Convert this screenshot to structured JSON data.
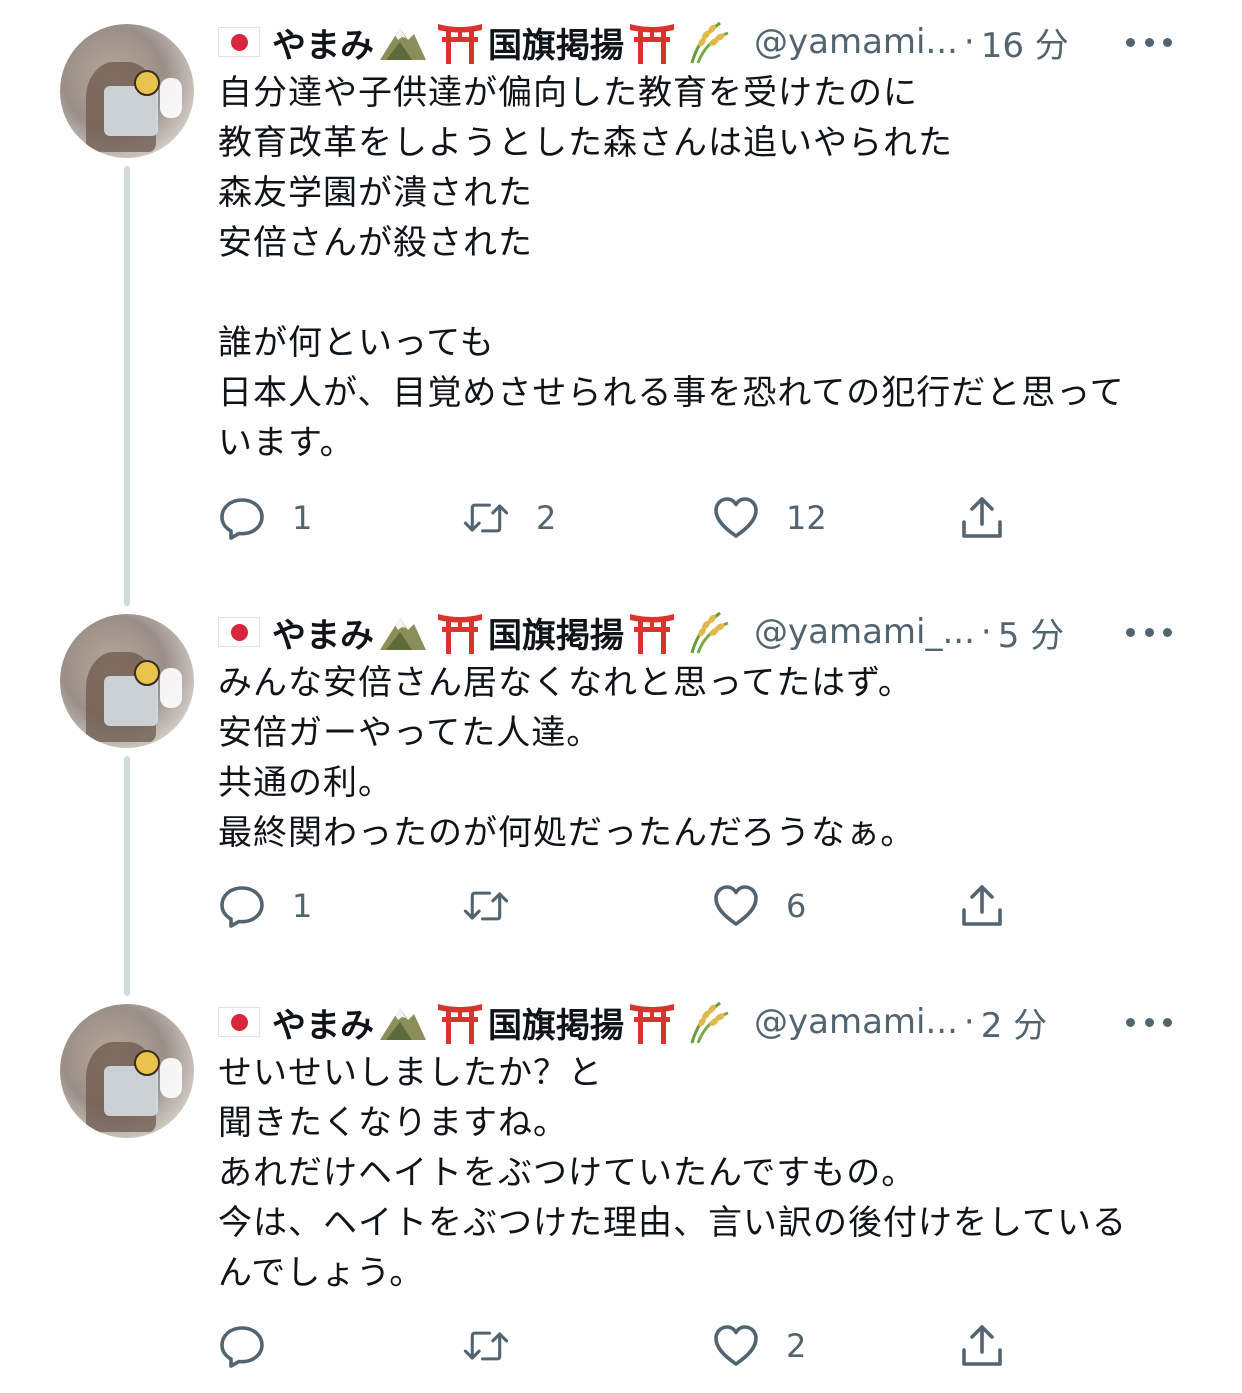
{
  "tweets": [
    {
      "display_name": "やまみ",
      "display_name_suffix": "国旗掲揚",
      "handle": "@yamami...",
      "separator": "·",
      "time": "16 分",
      "text": "自分達や子供達が偏向した教育を受けたのに\n教育改革をしようとした森さんは追いやられた\n森友学園が潰された\n安倍さんが殺された\n\n誰が何といっても\n日本人が、目覚めさせられる事を恐れての犯行だと思って\nいます。",
      "reply_count": "1",
      "retweet_count": "2",
      "like_count": "12"
    },
    {
      "display_name": "やまみ",
      "display_name_suffix": "国旗掲揚",
      "handle": "@yamami_...",
      "separator": "·",
      "time": "5 分",
      "text": "みんな安倍さん居なくなれと思ってたはず。\n安倍ガーやってた人達。\n共通の利。\n最終関わったのが何処だったんだろうなぁ。",
      "reply_count": "1",
      "retweet_count": "",
      "like_count": "6"
    },
    {
      "display_name": "やまみ",
      "display_name_suffix": "国旗掲揚",
      "handle": "@yamami...",
      "separator": "·",
      "time": "2 分",
      "text": "せいせいしましたか？と\n聞きたくなりますね。\nあれだけヘイトをぶつけていたんですもの。\n今は、ヘイトをぶつけた理由、言い訳の後付けをしている\nんでしょう。",
      "reply_count": "",
      "retweet_count": "",
      "like_count": "2"
    }
  ],
  "icons": {
    "flag": "japan-flag-icon",
    "mountain": "mountain-icon",
    "torii": "torii-gate-icon",
    "rice": "rice-plant-icon",
    "reply": "reply-icon",
    "retweet": "retweet-icon",
    "like": "heart-icon",
    "share": "share-icon",
    "more": "more-options-icon"
  },
  "colors": {
    "text": "#0f1419",
    "secondary": "#536471",
    "thread_line": "#cfd9de",
    "flag_red": "#d7263d",
    "torii_red": "#d9342b"
  }
}
